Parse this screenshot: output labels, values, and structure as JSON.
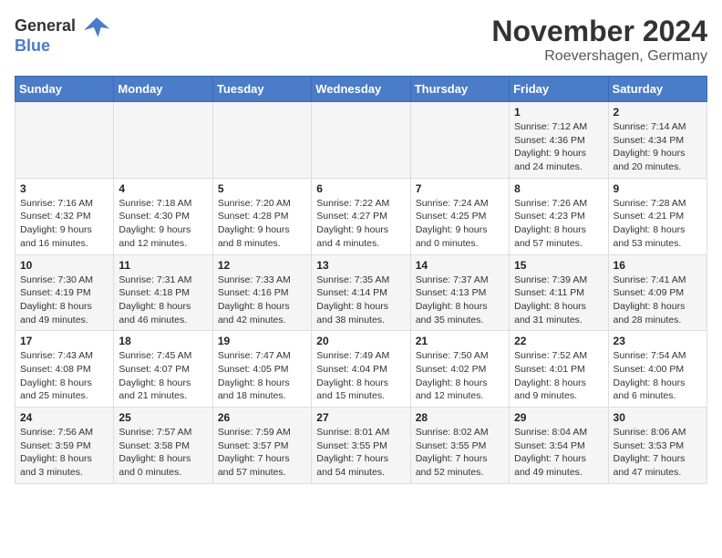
{
  "header": {
    "logo_general": "General",
    "logo_blue": "Blue",
    "month_title": "November 2024",
    "location": "Roevershagen, Germany"
  },
  "columns": [
    "Sunday",
    "Monday",
    "Tuesday",
    "Wednesday",
    "Thursday",
    "Friday",
    "Saturday"
  ],
  "weeks": [
    {
      "days": [
        {
          "num": "",
          "info": ""
        },
        {
          "num": "",
          "info": ""
        },
        {
          "num": "",
          "info": ""
        },
        {
          "num": "",
          "info": ""
        },
        {
          "num": "",
          "info": ""
        },
        {
          "num": "1",
          "info": "Sunrise: 7:12 AM\nSunset: 4:36 PM\nDaylight: 9 hours\nand 24 minutes."
        },
        {
          "num": "2",
          "info": "Sunrise: 7:14 AM\nSunset: 4:34 PM\nDaylight: 9 hours\nand 20 minutes."
        }
      ]
    },
    {
      "days": [
        {
          "num": "3",
          "info": "Sunrise: 7:16 AM\nSunset: 4:32 PM\nDaylight: 9 hours\nand 16 minutes."
        },
        {
          "num": "4",
          "info": "Sunrise: 7:18 AM\nSunset: 4:30 PM\nDaylight: 9 hours\nand 12 minutes."
        },
        {
          "num": "5",
          "info": "Sunrise: 7:20 AM\nSunset: 4:28 PM\nDaylight: 9 hours\nand 8 minutes."
        },
        {
          "num": "6",
          "info": "Sunrise: 7:22 AM\nSunset: 4:27 PM\nDaylight: 9 hours\nand 4 minutes."
        },
        {
          "num": "7",
          "info": "Sunrise: 7:24 AM\nSunset: 4:25 PM\nDaylight: 9 hours\nand 0 minutes."
        },
        {
          "num": "8",
          "info": "Sunrise: 7:26 AM\nSunset: 4:23 PM\nDaylight: 8 hours\nand 57 minutes."
        },
        {
          "num": "9",
          "info": "Sunrise: 7:28 AM\nSunset: 4:21 PM\nDaylight: 8 hours\nand 53 minutes."
        }
      ]
    },
    {
      "days": [
        {
          "num": "10",
          "info": "Sunrise: 7:30 AM\nSunset: 4:19 PM\nDaylight: 8 hours\nand 49 minutes."
        },
        {
          "num": "11",
          "info": "Sunrise: 7:31 AM\nSunset: 4:18 PM\nDaylight: 8 hours\nand 46 minutes."
        },
        {
          "num": "12",
          "info": "Sunrise: 7:33 AM\nSunset: 4:16 PM\nDaylight: 8 hours\nand 42 minutes."
        },
        {
          "num": "13",
          "info": "Sunrise: 7:35 AM\nSunset: 4:14 PM\nDaylight: 8 hours\nand 38 minutes."
        },
        {
          "num": "14",
          "info": "Sunrise: 7:37 AM\nSunset: 4:13 PM\nDaylight: 8 hours\nand 35 minutes."
        },
        {
          "num": "15",
          "info": "Sunrise: 7:39 AM\nSunset: 4:11 PM\nDaylight: 8 hours\nand 31 minutes."
        },
        {
          "num": "16",
          "info": "Sunrise: 7:41 AM\nSunset: 4:09 PM\nDaylight: 8 hours\nand 28 minutes."
        }
      ]
    },
    {
      "days": [
        {
          "num": "17",
          "info": "Sunrise: 7:43 AM\nSunset: 4:08 PM\nDaylight: 8 hours\nand 25 minutes."
        },
        {
          "num": "18",
          "info": "Sunrise: 7:45 AM\nSunset: 4:07 PM\nDaylight: 8 hours\nand 21 minutes."
        },
        {
          "num": "19",
          "info": "Sunrise: 7:47 AM\nSunset: 4:05 PM\nDaylight: 8 hours\nand 18 minutes."
        },
        {
          "num": "20",
          "info": "Sunrise: 7:49 AM\nSunset: 4:04 PM\nDaylight: 8 hours\nand 15 minutes."
        },
        {
          "num": "21",
          "info": "Sunrise: 7:50 AM\nSunset: 4:02 PM\nDaylight: 8 hours\nand 12 minutes."
        },
        {
          "num": "22",
          "info": "Sunrise: 7:52 AM\nSunset: 4:01 PM\nDaylight: 8 hours\nand 9 minutes."
        },
        {
          "num": "23",
          "info": "Sunrise: 7:54 AM\nSunset: 4:00 PM\nDaylight: 8 hours\nand 6 minutes."
        }
      ]
    },
    {
      "days": [
        {
          "num": "24",
          "info": "Sunrise: 7:56 AM\nSunset: 3:59 PM\nDaylight: 8 hours\nand 3 minutes."
        },
        {
          "num": "25",
          "info": "Sunrise: 7:57 AM\nSunset: 3:58 PM\nDaylight: 8 hours\nand 0 minutes."
        },
        {
          "num": "26",
          "info": "Sunrise: 7:59 AM\nSunset: 3:57 PM\nDaylight: 7 hours\nand 57 minutes."
        },
        {
          "num": "27",
          "info": "Sunrise: 8:01 AM\nSunset: 3:55 PM\nDaylight: 7 hours\nand 54 minutes."
        },
        {
          "num": "28",
          "info": "Sunrise: 8:02 AM\nSunset: 3:55 PM\nDaylight: 7 hours\nand 52 minutes."
        },
        {
          "num": "29",
          "info": "Sunrise: 8:04 AM\nSunset: 3:54 PM\nDaylight: 7 hours\nand 49 minutes."
        },
        {
          "num": "30",
          "info": "Sunrise: 8:06 AM\nSunset: 3:53 PM\nDaylight: 7 hours\nand 47 minutes."
        }
      ]
    }
  ]
}
